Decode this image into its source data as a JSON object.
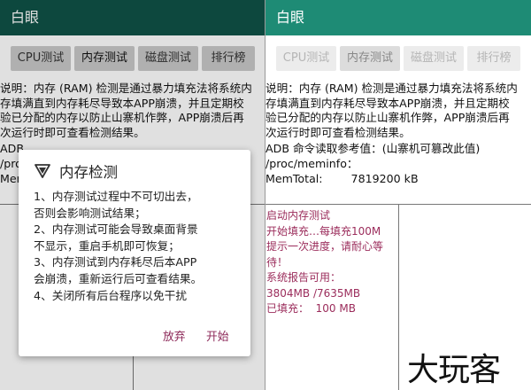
{
  "left": {
    "app_title": "白眼",
    "tabs": [
      {
        "label": "CPU测试"
      },
      {
        "label": "内存测试"
      },
      {
        "label": "磁盘测试"
      },
      {
        "label": "排行榜"
      }
    ],
    "description_lines": [
      "说明：内存 (RAM) 检测是通过暴力填充法将系统内",
      "存填满直到内存耗尽导致本APP崩溃，并且定期校",
      "验已分配的内存以防止山寨机作弊，APP崩溃后再",
      "次运行时即可查看检测结果。"
    ],
    "adb_partial": [
      "ADB",
      "/proc",
      "Mem"
    ]
  },
  "dialog": {
    "title": "内存检测",
    "lines": [
      "1、内存测试过程中不可切出去，",
      "否则会影响测试结果；",
      "2、内存测试可能会导致桌面背景",
      "不显示，重启手机即可恢复；",
      "3、内存测试到内存耗尽后本APP",
      "会崩溃，重新运行后可查看结果。",
      "4、关闭所有后台程序以免干扰"
    ],
    "cancel_label": "放弃",
    "start_label": "开始"
  },
  "right": {
    "app_title": "白眼",
    "tabs": [
      {
        "label": "CPU测试"
      },
      {
        "label": "内存测试"
      },
      {
        "label": "磁盘测试"
      },
      {
        "label": "排行榜"
      }
    ],
    "description_lines": [
      "说明：内存 (RAM) 检测是通过暴力填充法将系统内",
      "存填满直到内存耗尽导致本APP崩溃，并且定期校",
      "验已分配的内存以防止山寨机作弊，APP崩溃后再",
      "次运行时即可查看检测结果。"
    ],
    "adb_lines": [
      "ADB 命令读取参考值：(山寨机可篡改此值)",
      "/proc/meminfo：",
      "MemTotal:        7819200 kB"
    ],
    "log_lines": [
      "启动内存测试",
      "开始填充…每填充100M",
      "提示一次进度，请耐心等",
      "待！",
      "系统报告可用：",
      "3804MB /7635MB",
      "已填充：  100 MB"
    ]
  },
  "watermark": "大玩客",
  "colors": {
    "appbar_dark": "#0f5347",
    "appbar_light": "#1e8b75",
    "accent_magenta": "#8c2858"
  }
}
